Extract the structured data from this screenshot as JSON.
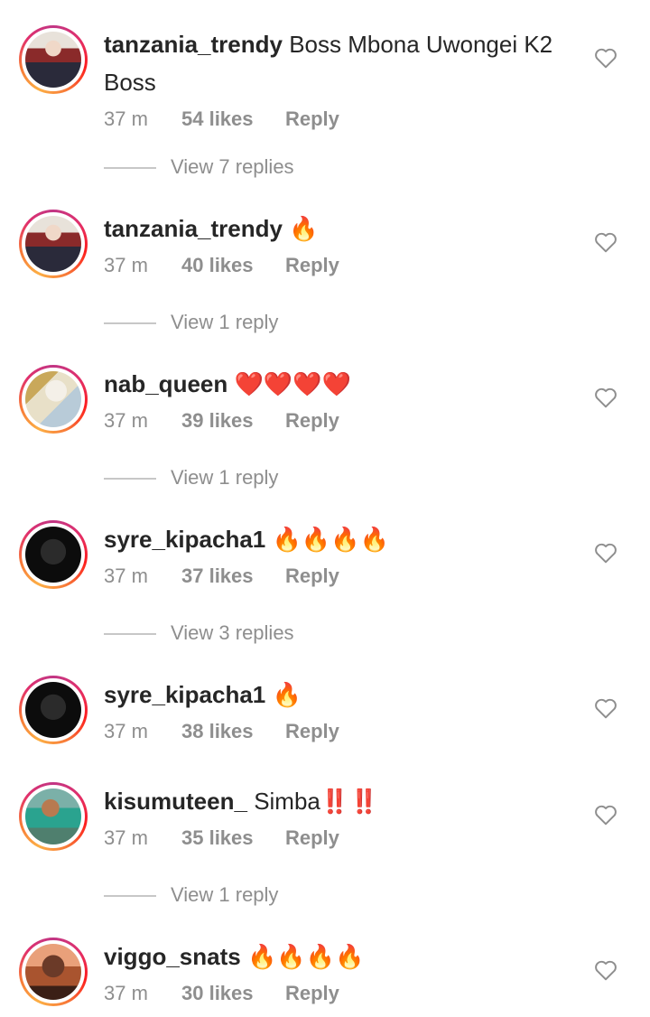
{
  "comments": [
    {
      "username": "tanzania_trendy",
      "text": "Boss Mbona Uwongei K2 Boss",
      "time": "37 m",
      "likes": "54 likes",
      "reply": "Reply",
      "avatar": "avatar-person-red-scarf",
      "view_replies": "View 7 replies"
    },
    {
      "username": "tanzania_trendy",
      "text": "🔥",
      "time": "37 m",
      "likes": "40 likes",
      "reply": "Reply",
      "avatar": "avatar-person-red-scarf",
      "view_replies": "View 1 reply"
    },
    {
      "username": "nab_queen",
      "text": "❤️❤️❤️❤️",
      "time": "37 m",
      "likes": "39 likes",
      "reply": "Reply",
      "avatar": "avatar-woman-white-hijab",
      "view_replies": "View 1 reply"
    },
    {
      "username": "syre_kipacha1",
      "text": "🔥🔥🔥🔥",
      "time": "37 m",
      "likes": "37 likes",
      "reply": "Reply",
      "avatar": "avatar-dark-portrait",
      "view_replies": "View 3 replies"
    },
    {
      "username": "syre_kipacha1",
      "text": "🔥",
      "time": "37 m",
      "likes": "38 likes",
      "reply": "Reply",
      "avatar": "avatar-dark-portrait",
      "view_replies": ""
    },
    {
      "username": "kisumuteen_",
      "text": "Simba‼️‼️",
      "time": "37 m",
      "likes": "35 likes",
      "reply": "Reply",
      "avatar": "avatar-person-teal",
      "view_replies": "View 1 reply"
    },
    {
      "username": "viggo_snats",
      "text": "🔥🔥🔥🔥",
      "time": "37 m",
      "likes": "30 likes",
      "reply": "Reply",
      "avatar": "avatar-red-hair",
      "view_replies": ""
    }
  ],
  "icons": {
    "like": "heart-outline-icon"
  },
  "colors": {
    "text": "#262626",
    "secondary": "#8e8e8e",
    "story_ring_start": "#c13584",
    "story_ring_end": "#fcaf45"
  }
}
